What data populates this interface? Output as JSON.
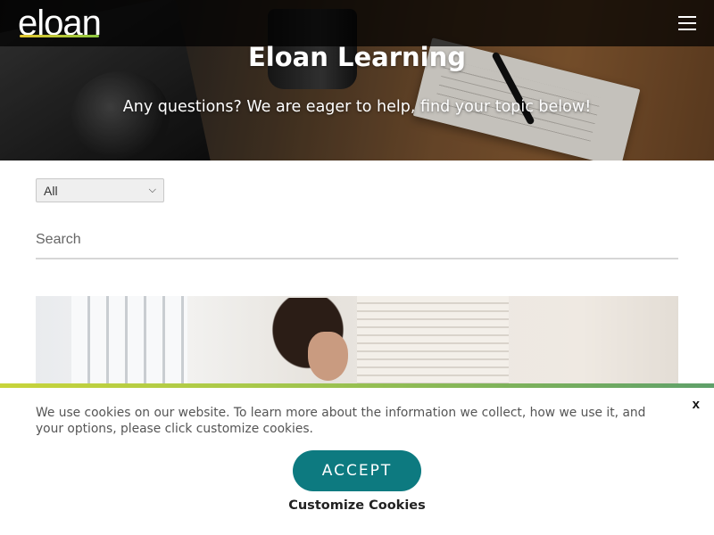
{
  "header": {
    "logo_text": "eloan",
    "menu_icon": "hamburger-menu-icon"
  },
  "hero": {
    "title": "Eloan Learning",
    "subtitle": "Any questions? We are eager to help, find your topic below!"
  },
  "filters": {
    "category_selected": "All",
    "search_placeholder": "Search"
  },
  "cookie": {
    "message": "We use cookies on our website. To learn more about the information we collect, how we use it, and your options, please click customize cookies.",
    "close_label": "x",
    "accept_label": "ACCEPT",
    "customize_label": "Customize Cookies",
    "accent_color": "#0d7a80"
  }
}
